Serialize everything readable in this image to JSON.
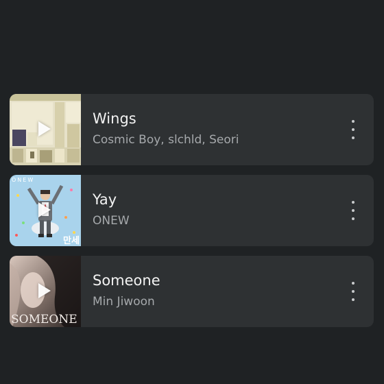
{
  "songs": [
    {
      "title": "Wings",
      "artist": "Cosmic Boy, slchld, Seori",
      "play_icon": "play-icon",
      "more_icon": "more-vert-icon"
    },
    {
      "title": "Yay",
      "artist": "ONEW",
      "art_text_top": "ONEW",
      "art_text_side": "만세",
      "play_icon": "play-icon",
      "more_icon": "more-vert-icon"
    },
    {
      "title": "Someone",
      "artist": "Min Jiwoon",
      "art_text": "SOMEONE",
      "play_icon": "play-icon",
      "more_icon": "more-vert-icon"
    }
  ],
  "colors": {
    "background": "#1f2224",
    "card": "#2e3133",
    "title": "#f2f2f2",
    "subtitle": "#a6a9ac"
  }
}
